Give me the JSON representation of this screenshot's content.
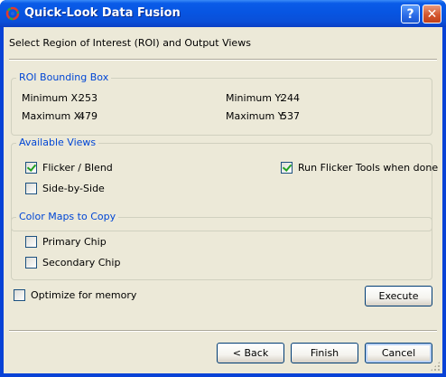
{
  "window": {
    "title": "Quick-Look Data Fusion",
    "help_glyph": "?",
    "close_glyph": "✕"
  },
  "instructions": "Select Region of Interest (ROI) and Output Views",
  "roi": {
    "title": "ROI Bounding Box",
    "min_x_label": "Minimum X:",
    "min_x": "253",
    "max_x_label": "Maximum X:",
    "max_x": "479",
    "min_y_label": "Minimum Y:",
    "min_y": "244",
    "max_y_label": "Maximum Y:",
    "max_y": "537"
  },
  "views": {
    "title": "Available Views",
    "flicker_blend": {
      "label": "Flicker / Blend",
      "checked": true
    },
    "side_by_side": {
      "label": "Side-by-Side",
      "checked": false
    },
    "run_flicker_tools": {
      "label": "Run Flicker Tools when done",
      "checked": true
    }
  },
  "color_maps": {
    "title": "Color Maps to Copy",
    "primary_chip": {
      "label": "Primary Chip",
      "checked": false
    },
    "secondary_chip": {
      "label": "Secondary Chip",
      "checked": false
    }
  },
  "optimize_memory": {
    "label": "Optimize for memory",
    "checked": false
  },
  "buttons": {
    "execute": "Execute",
    "back": "< Back",
    "finish": "Finish",
    "cancel": "Cancel"
  },
  "colors": {
    "titlebar": "#0a5ce8",
    "client_bg": "#ece9d8",
    "group_label": "#0046d5",
    "check": "#21a121"
  }
}
